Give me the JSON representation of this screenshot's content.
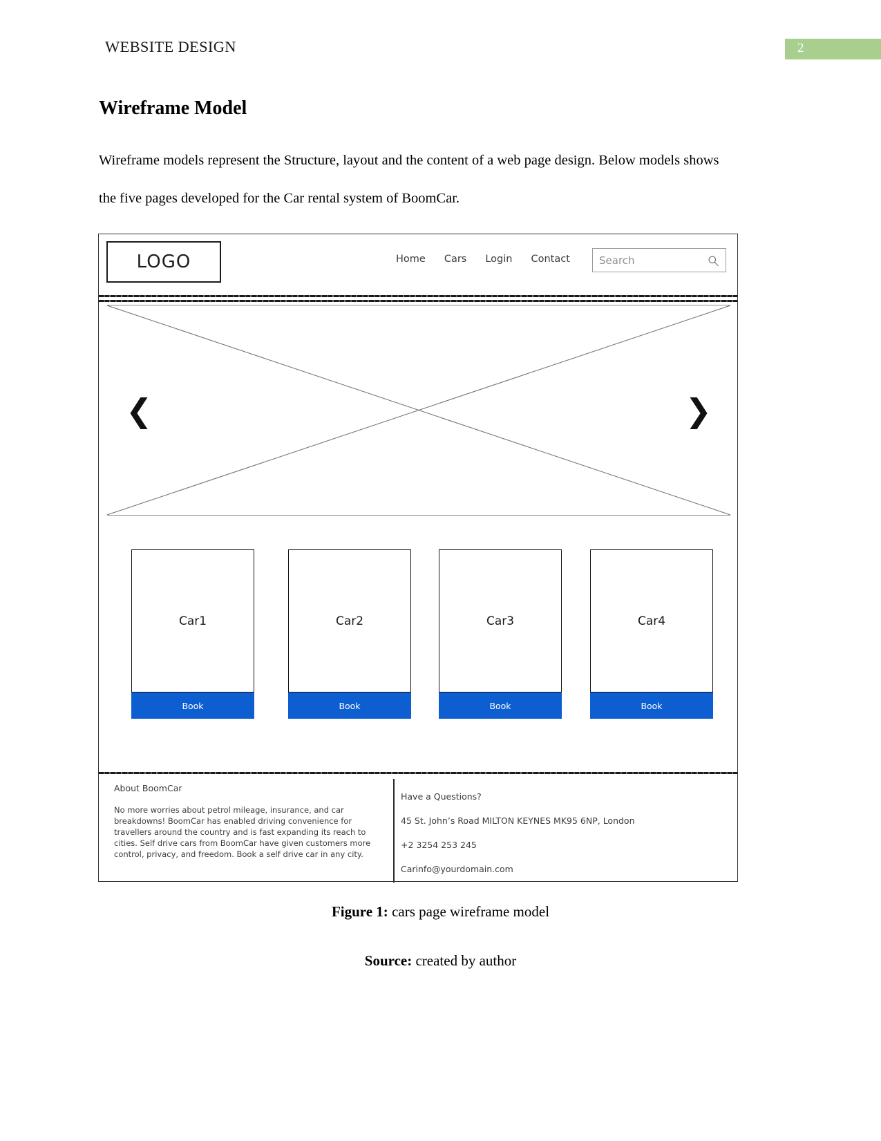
{
  "header": {
    "title": "WEBSITE DESIGN",
    "page_number": "2",
    "page_number_bg": "#a8cf8e"
  },
  "document": {
    "section_title": "Wireframe Model",
    "paragraph": "Wireframe models represent the Structure, layout and the content of a web page design. Below models shows the five pages developed for the Car rental system of BoomCar."
  },
  "wireframe": {
    "logo": "LOGO",
    "nav_links": [
      {
        "label": "Home"
      },
      {
        "label": "Cars"
      },
      {
        "label": "Login"
      },
      {
        "label": "Contact"
      }
    ],
    "search": {
      "placeholder": "Search",
      "value": "",
      "icon": "search-icon"
    },
    "hero": {
      "prev_icon": "❮",
      "next_icon": "❯",
      "placeholder_type": "crossed-box-image-placeholder"
    },
    "cards": [
      {
        "label": "Car1",
        "button": "Book"
      },
      {
        "label": "Car2",
        "button": "Book"
      },
      {
        "label": "Car3",
        "button": "Book"
      },
      {
        "label": "Car4",
        "button": "Book"
      }
    ],
    "button_color": "#0d5ed0",
    "footer": {
      "left": {
        "heading": "About BoomCar",
        "body": "No more worries about petrol mileage, insurance, and car breakdowns! BoomCar has enabled driving convenience for travellers around the country and is fast expanding its reach to cities. Self drive cars from BoomCar have given customers more control, privacy, and freedom. Book a self drive car in any city."
      },
      "right": {
        "heading": "Have a Questions?",
        "address": "45 St. John’s Road MILTON KEYNES MK95 6NP, London",
        "phone": "+2 3254 253 245",
        "email": "Carinfo@yourdomain.com"
      }
    }
  },
  "captions": {
    "figure_label": "Figure 1:",
    "figure_text": " cars page wireframe model",
    "source_label": "Source:",
    "source_text": " created by author"
  }
}
